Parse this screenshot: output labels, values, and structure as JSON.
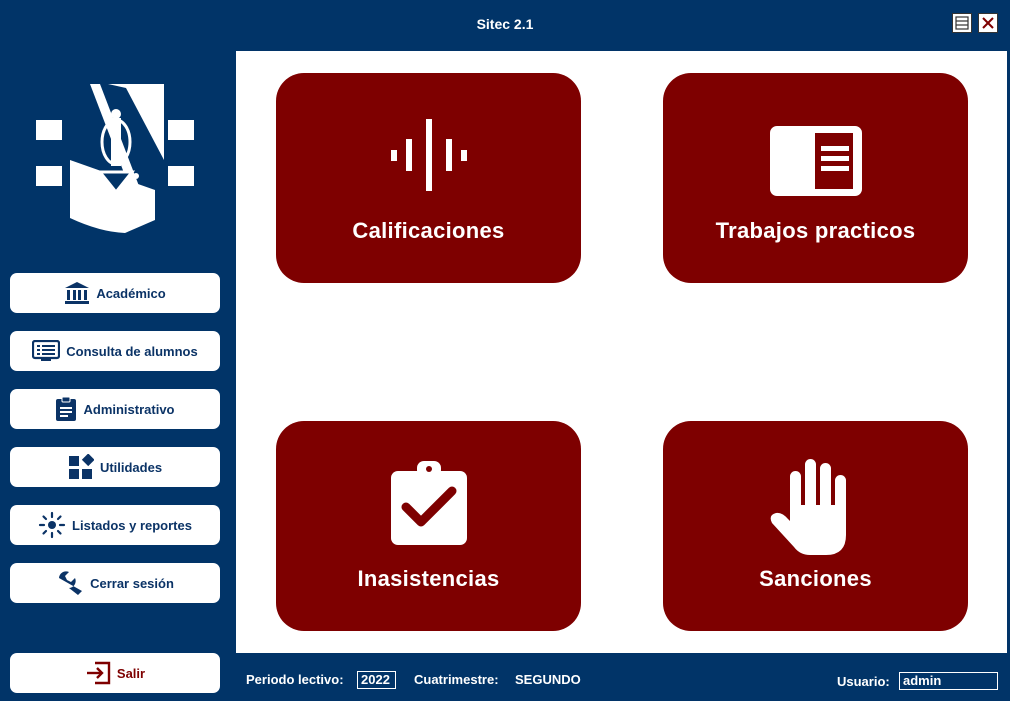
{
  "window": {
    "title": "Sitec 2.1"
  },
  "sidebar": {
    "items": [
      {
        "label": "Académico",
        "icon": "institution-icon"
      },
      {
        "label": "Consulta de alumnos",
        "icon": "list-screen-icon"
      },
      {
        "label": "Administrativo",
        "icon": "clipboard-icon"
      },
      {
        "label": "Utilidades",
        "icon": "widgets-icon"
      },
      {
        "label": "Listados y reportes",
        "icon": "brightness-icon"
      },
      {
        "label": "Cerrar sesión",
        "icon": "wrench-icon"
      }
    ],
    "exit_label": "Salir"
  },
  "tiles": [
    {
      "label": "Calificaciones",
      "icon": "audio-bars-icon"
    },
    {
      "label": "Trabajos practicos",
      "icon": "document-panel-icon"
    },
    {
      "label": "Inasistencias",
      "icon": "clipboard-check-icon"
    },
    {
      "label": "Sanciones",
      "icon": "hand-stop-icon"
    }
  ],
  "status": {
    "period_label": "Periodo lectivo:",
    "period_value": "2022",
    "term_label": "Cuatrimestre:",
    "term_value": "SEGUNDO",
    "user_label": "Usuario:",
    "user_value": "admin"
  },
  "colors": {
    "navy": "#013468",
    "maroon": "#7e0000",
    "white": "#ffffff"
  }
}
